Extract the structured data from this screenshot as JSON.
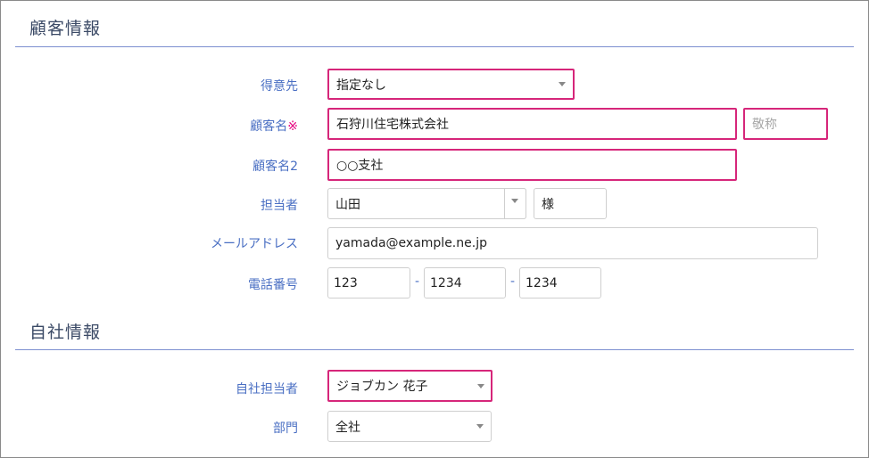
{
  "customer_section": {
    "title": "顧客情報"
  },
  "company_section": {
    "title": "自社情報"
  },
  "customer": {
    "client": {
      "label": "得意先",
      "value": "指定なし"
    },
    "name": {
      "label": "顧客名",
      "required_mark": "※",
      "value": "石狩川住宅株式会社",
      "honorific_placeholder": "敬称"
    },
    "name2": {
      "label": "顧客名2",
      "value": "○○支社"
    },
    "person": {
      "label": "担当者",
      "value": "山田",
      "honorific": "様"
    },
    "email": {
      "label": "メールアドレス",
      "value": "yamada@example.ne.jp"
    },
    "phone": {
      "label": "電話番号",
      "part1": "123",
      "part2": "1234",
      "part3": "1234",
      "separator": "-"
    }
  },
  "company": {
    "staff": {
      "label": "自社担当者",
      "value": "ジョブカン 花子"
    },
    "department": {
      "label": "部門",
      "value": "全社"
    }
  },
  "colors": {
    "label": "#4a6fc3",
    "highlight": "#d6267a",
    "required": "#e5007f",
    "section_line": "#7c8fd0"
  }
}
